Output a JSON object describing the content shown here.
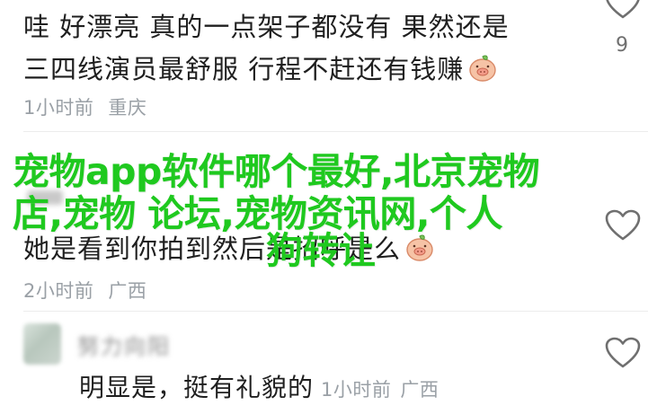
{
  "comments": [
    {
      "line1": "哇 好漂亮 真的一点架子都没有 果然还是",
      "line2": "三四线演员最舒服 行程不赶还有钱赚",
      "time": "1小时前",
      "location": "重庆",
      "like_count": "9"
    },
    {
      "text": "她是看到你拍到然后是招呼是么",
      "time": "2小时前",
      "location": "广西"
    },
    {
      "author": "努力向阳",
      "reply_text": "明显是，挺有礼貌的",
      "time": "1小时前",
      "location": "广西"
    }
  ],
  "watermark": {
    "line1": "宠物app软件哪个最好,北京宠物",
    "line2": "店,宠物 论坛,宠物资讯网,个人",
    "line3": "狗转让",
    "color": "#1fc91f"
  },
  "icons": {
    "like": "heart-outline-icon",
    "emoji": "pig-face-emoji-icon"
  }
}
